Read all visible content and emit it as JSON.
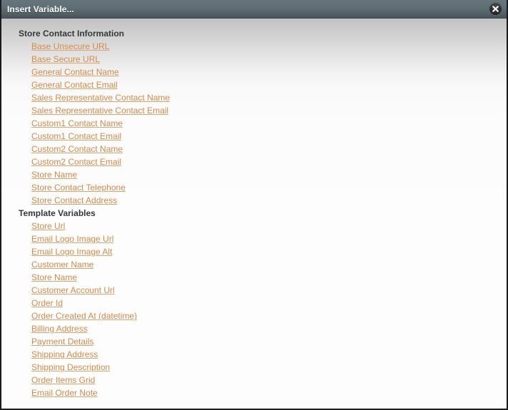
{
  "window": {
    "title": "Insert Variable...",
    "close_icon": "close-icon",
    "accent_link_color": "#d4894a",
    "titlebar_color": "#5d6e74"
  },
  "sections": [
    {
      "title": "Store Contact Information",
      "items": [
        "Base Unsecure URL",
        "Base Secure URL",
        "General Contact Name",
        "General Contact Email",
        "Sales Representative Contact Name",
        "Sales Representative Contact Email",
        "Custom1 Contact Name",
        "Custom1 Contact Email",
        "Custom2 Contact Name",
        "Custom2 Contact Email",
        "Store Name",
        "Store Contact Telephone",
        "Store Contact Address"
      ]
    },
    {
      "title": "Template Variables",
      "items": [
        "Store Url",
        "Email Logo Image Url",
        "Email Logo Image Alt",
        "Customer Name",
        "Store Name",
        "Customer Account Url",
        "Order Id",
        "Order Created At (datetime)",
        "Billing Address",
        "Payment Details",
        "Shipping Address",
        "Shipping Description",
        "Order Items Grid",
        "Email Order Note"
      ]
    }
  ]
}
